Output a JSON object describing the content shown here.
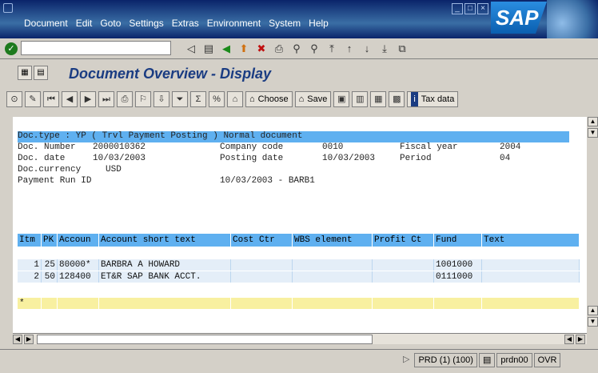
{
  "menubar": {
    "items": [
      "Document",
      "Edit",
      "Goto",
      "Settings",
      "Extras",
      "Environment",
      "System",
      "Help"
    ],
    "logo": "SAP"
  },
  "page": {
    "title": "Document Overview - Display"
  },
  "toolbar": {
    "choose_label": "Choose",
    "save_label": "Save",
    "tax_label": "Tax data"
  },
  "header": {
    "doc_type_line": "Doc.type : YP ( Trvl Payment Posting ) Normal document",
    "row1": {
      "l1": "Doc. Number",
      "v1": "2000010362",
      "l2": "Company code",
      "v2": "0010",
      "l3": "Fiscal year",
      "v3": "2004"
    },
    "row2": {
      "l1": "Doc. date",
      "v1": "10/03/2003",
      "l2": "Posting date",
      "v2": "10/03/2003",
      "l3": "Period",
      "v3": "04"
    },
    "row3": {
      "l1": "Doc.currency",
      "v1": "USD"
    },
    "row4": {
      "l1": "Payment Run ID",
      "v1": "10/03/2003 - BARB1"
    }
  },
  "table": {
    "columns": [
      "Itm",
      "PK",
      "Accoun",
      "Account short text",
      "Cost Ctr",
      "WBS element",
      "Profit Ct",
      "Fund",
      "Text"
    ],
    "rows": [
      {
        "itm": "1",
        "pk": "25",
        "acct": "80000*",
        "text": "BARBRA A HOWARD",
        "fund": "1001000"
      },
      {
        "itm": "2",
        "pk": "50",
        "acct": "128400",
        "text": "ET&R SAP BANK ACCT.",
        "fund": "0111000"
      }
    ],
    "empty_marker": "*"
  },
  "status": {
    "system": "PRD (1) (100)",
    "server": "prdn00",
    "mode": "OVR"
  }
}
